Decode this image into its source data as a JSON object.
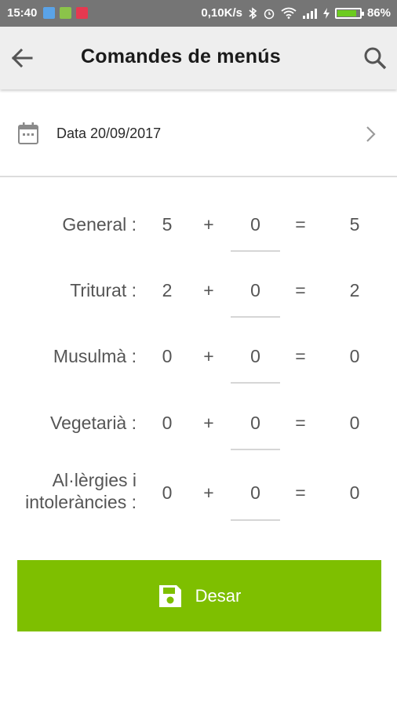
{
  "status_bar": {
    "time": "15:40",
    "speed": "0,10K/s",
    "battery": "86%",
    "battery_level": 0.86
  },
  "app_bar": {
    "title": "Comandes de menús",
    "back_icon": "arrow-left-icon",
    "search_icon": "search-icon"
  },
  "date_row": {
    "text": "Data 20/09/2017",
    "icon": "calendar-icon",
    "chevron": "chevron-right-icon"
  },
  "rows": [
    {
      "label": "General :",
      "base": "5",
      "plus": "+",
      "qty": "0",
      "eq": "=",
      "total": "5"
    },
    {
      "label": "Triturat :",
      "base": "2",
      "plus": "+",
      "qty": "0",
      "eq": "=",
      "total": "2"
    },
    {
      "label": "Musulmà :",
      "base": "0",
      "plus": "+",
      "qty": "0",
      "eq": "=",
      "total": "0"
    },
    {
      "label": "Vegetarià :",
      "base": "0",
      "plus": "+",
      "qty": "0",
      "eq": "=",
      "total": "0"
    },
    {
      "label_line1": "Al·lèrgies i",
      "label_line2": "intoleràncies :",
      "base": "0",
      "plus": "+",
      "qty": "0",
      "eq": "=",
      "total": "0"
    }
  ],
  "save_button": {
    "label": "Desar",
    "icon": "save-icon",
    "color": "#7ebf00"
  }
}
